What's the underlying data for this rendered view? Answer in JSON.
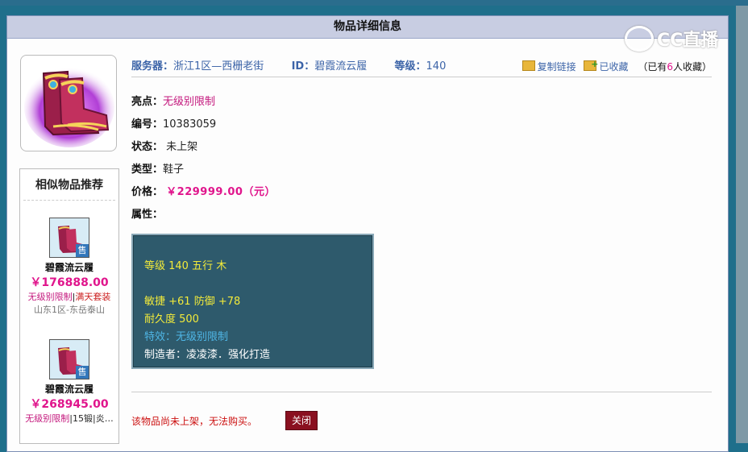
{
  "window": {
    "title": "物品详细信息"
  },
  "watermark": {
    "text": "CC直播"
  },
  "item": {
    "server_label": "服务器：",
    "server_value": "浙江1区—西栅老街",
    "id_label": "ID：",
    "id_value": "碧霞流云履",
    "level_label": "等级：",
    "level_value": "140",
    "highlight_label": "亮点：",
    "highlight_value": "无级别限制",
    "number_label": "编号：",
    "number_value": "10383059",
    "status_label": "状态：",
    "status_value": "未上架",
    "type_label": "类型：",
    "type_value": "鞋子",
    "price_label": "价格：",
    "price_value": "￥229999.00（元）",
    "attr_label": "属性："
  },
  "actions": {
    "copy_link": "复制链接",
    "favorited": "已收藏",
    "fav_prefix": "（已有",
    "fav_count": "6",
    "fav_suffix": "人收藏）"
  },
  "attributes": {
    "line1": "等级 140 五行 木",
    "line2": "敏捷 +61 防御 +78",
    "line3": "耐久度 500",
    "line4": "特效：无级别限制",
    "line5": "制造者：凌凌漆．强化打造"
  },
  "recommend": {
    "title": "相似物品推荐",
    "sell_tag": "售",
    "items": [
      {
        "name": "碧霞流云履",
        "price": "￥176888.00",
        "tag1": "无级别限制",
        "sep": "|",
        "tag2": "满天套装",
        "server": "山东1区-东岳泰山"
      },
      {
        "name": "碧霞流云履",
        "price": "￥268945.00",
        "tag1": "无级别限制",
        "sep": "|",
        "tag2": "15锻|炎…",
        "server": ""
      }
    ]
  },
  "footer": {
    "notice": "该物品尚未上架，无法购买。",
    "close_label": "关闭"
  },
  "colors": {
    "background": "#1f6f8b",
    "title_bar": "#c8cde2",
    "price_pink": "#e0158c",
    "attr_box": "#2e5a6c",
    "close_button": "#8a1020"
  }
}
